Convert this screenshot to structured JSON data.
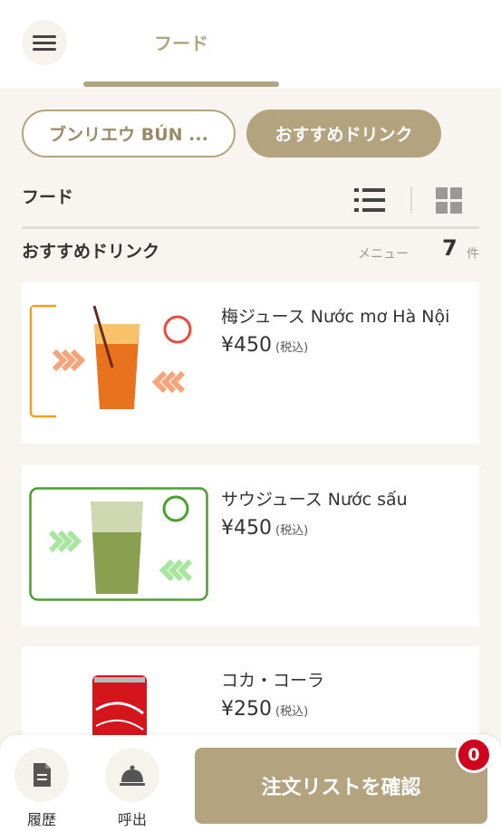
{
  "header": {
    "tab_label": "フード"
  },
  "category_pills": [
    {
      "label": "ブンリエウ BÚN ..."
    },
    {
      "label": "おすすめドリンク"
    }
  ],
  "section": {
    "title": "フード",
    "category_title": "おすすめドリンク",
    "menu_label": "メニュー",
    "count": "7",
    "count_unit": "件"
  },
  "items": [
    {
      "name": "梅ジュース Nước mơ Hà Nội",
      "price": "¥450",
      "tax": "(税込)"
    },
    {
      "name": "サウジュース Nước sấu",
      "price": "¥450",
      "tax": "(税込)"
    },
    {
      "name": "コカ・コーラ",
      "price": "¥250",
      "tax": "(税込)"
    }
  ],
  "bottom": {
    "history_label": "履歴",
    "call_label": "呼出",
    "confirm_label": "注文リストを確認",
    "cart_count": "0"
  },
  "colors": {
    "accent": "#b3a47f",
    "background": "#f8f5f0",
    "badge": "#d0021b"
  }
}
